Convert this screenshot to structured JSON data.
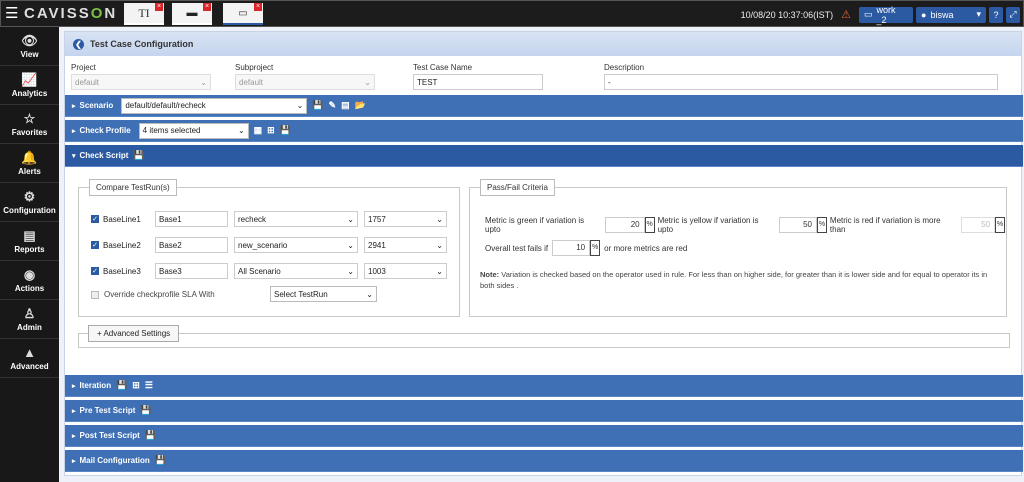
{
  "app": {
    "logo_a": "CAVISS",
    "logo_o": "O",
    "logo_b": "N",
    "datetime": "10/08/20 10:37:06(IST)",
    "workspace": "work _2",
    "user": "biswa"
  },
  "sidebar": [
    {
      "icon": "eye-icon",
      "glyph": "👁",
      "label": "View"
    },
    {
      "icon": "chart-icon",
      "glyph": "📈",
      "label": "Analytics"
    },
    {
      "icon": "star-icon",
      "glyph": "☆",
      "label": "Favorites"
    },
    {
      "icon": "bell-icon",
      "glyph": "🔔",
      "label": "Alerts"
    },
    {
      "icon": "gears-icon",
      "glyph": "⚙",
      "label": "Configuration"
    },
    {
      "icon": "report-icon",
      "glyph": "▤",
      "label": "Reports"
    },
    {
      "icon": "actions-icon",
      "glyph": "◉",
      "label": "Actions"
    },
    {
      "icon": "user-icon",
      "glyph": "♙",
      "label": "Admin"
    },
    {
      "icon": "advanced-icon",
      "glyph": "▲",
      "label": "Advanced"
    }
  ],
  "page": {
    "title": "Test Case Configuration",
    "project": {
      "label": "Project",
      "value": "default"
    },
    "subproject": {
      "label": "Subproject",
      "value": "default"
    },
    "name": {
      "label": "Test Case Name",
      "value": "TEST"
    },
    "desc": {
      "label": "Description",
      "value": "-"
    }
  },
  "scenario": {
    "label": "Scenario",
    "value": "default/default/recheck"
  },
  "check_profile": {
    "label": "Check Profile",
    "value": "4 items selected"
  },
  "check_script": {
    "label": "Check Script"
  },
  "compare": {
    "legend": "Compare TestRun(s)",
    "rows": [
      {
        "label": "BaseLine1",
        "name": "Base1",
        "scenario": "recheck",
        "run": "1757"
      },
      {
        "label": "BaseLine2",
        "name": "Base2",
        "scenario": "new_scenario",
        "run": "2941"
      },
      {
        "label": "BaseLine3",
        "name": "Base3",
        "scenario": "All Scenario",
        "run": "1003"
      }
    ],
    "override": "Override checkprofile SLA With",
    "select_run": "Select TestRun"
  },
  "criteria": {
    "legend": "Pass/Fail Criteria",
    "green_lbl": "Metric is green if variation is upto",
    "green": "20",
    "yellow_lbl": "Metric is yellow if variation is upto",
    "yellow": "50",
    "red_lbl": "Metric is red if variation is more than",
    "red": "50",
    "overall_lbl": "Overall test fails if",
    "overall": "10",
    "overall_tail": "or more metrics are red",
    "pct": "%",
    "note_b": "Note:",
    "note": " Variation is checked based on the operator used in rule. For less than on higher side, for greater than it is lower side and for equal to operator its in both sides ."
  },
  "advanced": "+ Advanced Settings",
  "sections": {
    "iteration": "Iteration",
    "pre": "Pre Test Script",
    "post": "Post Test Script",
    "mail": "Mail Configuration"
  }
}
